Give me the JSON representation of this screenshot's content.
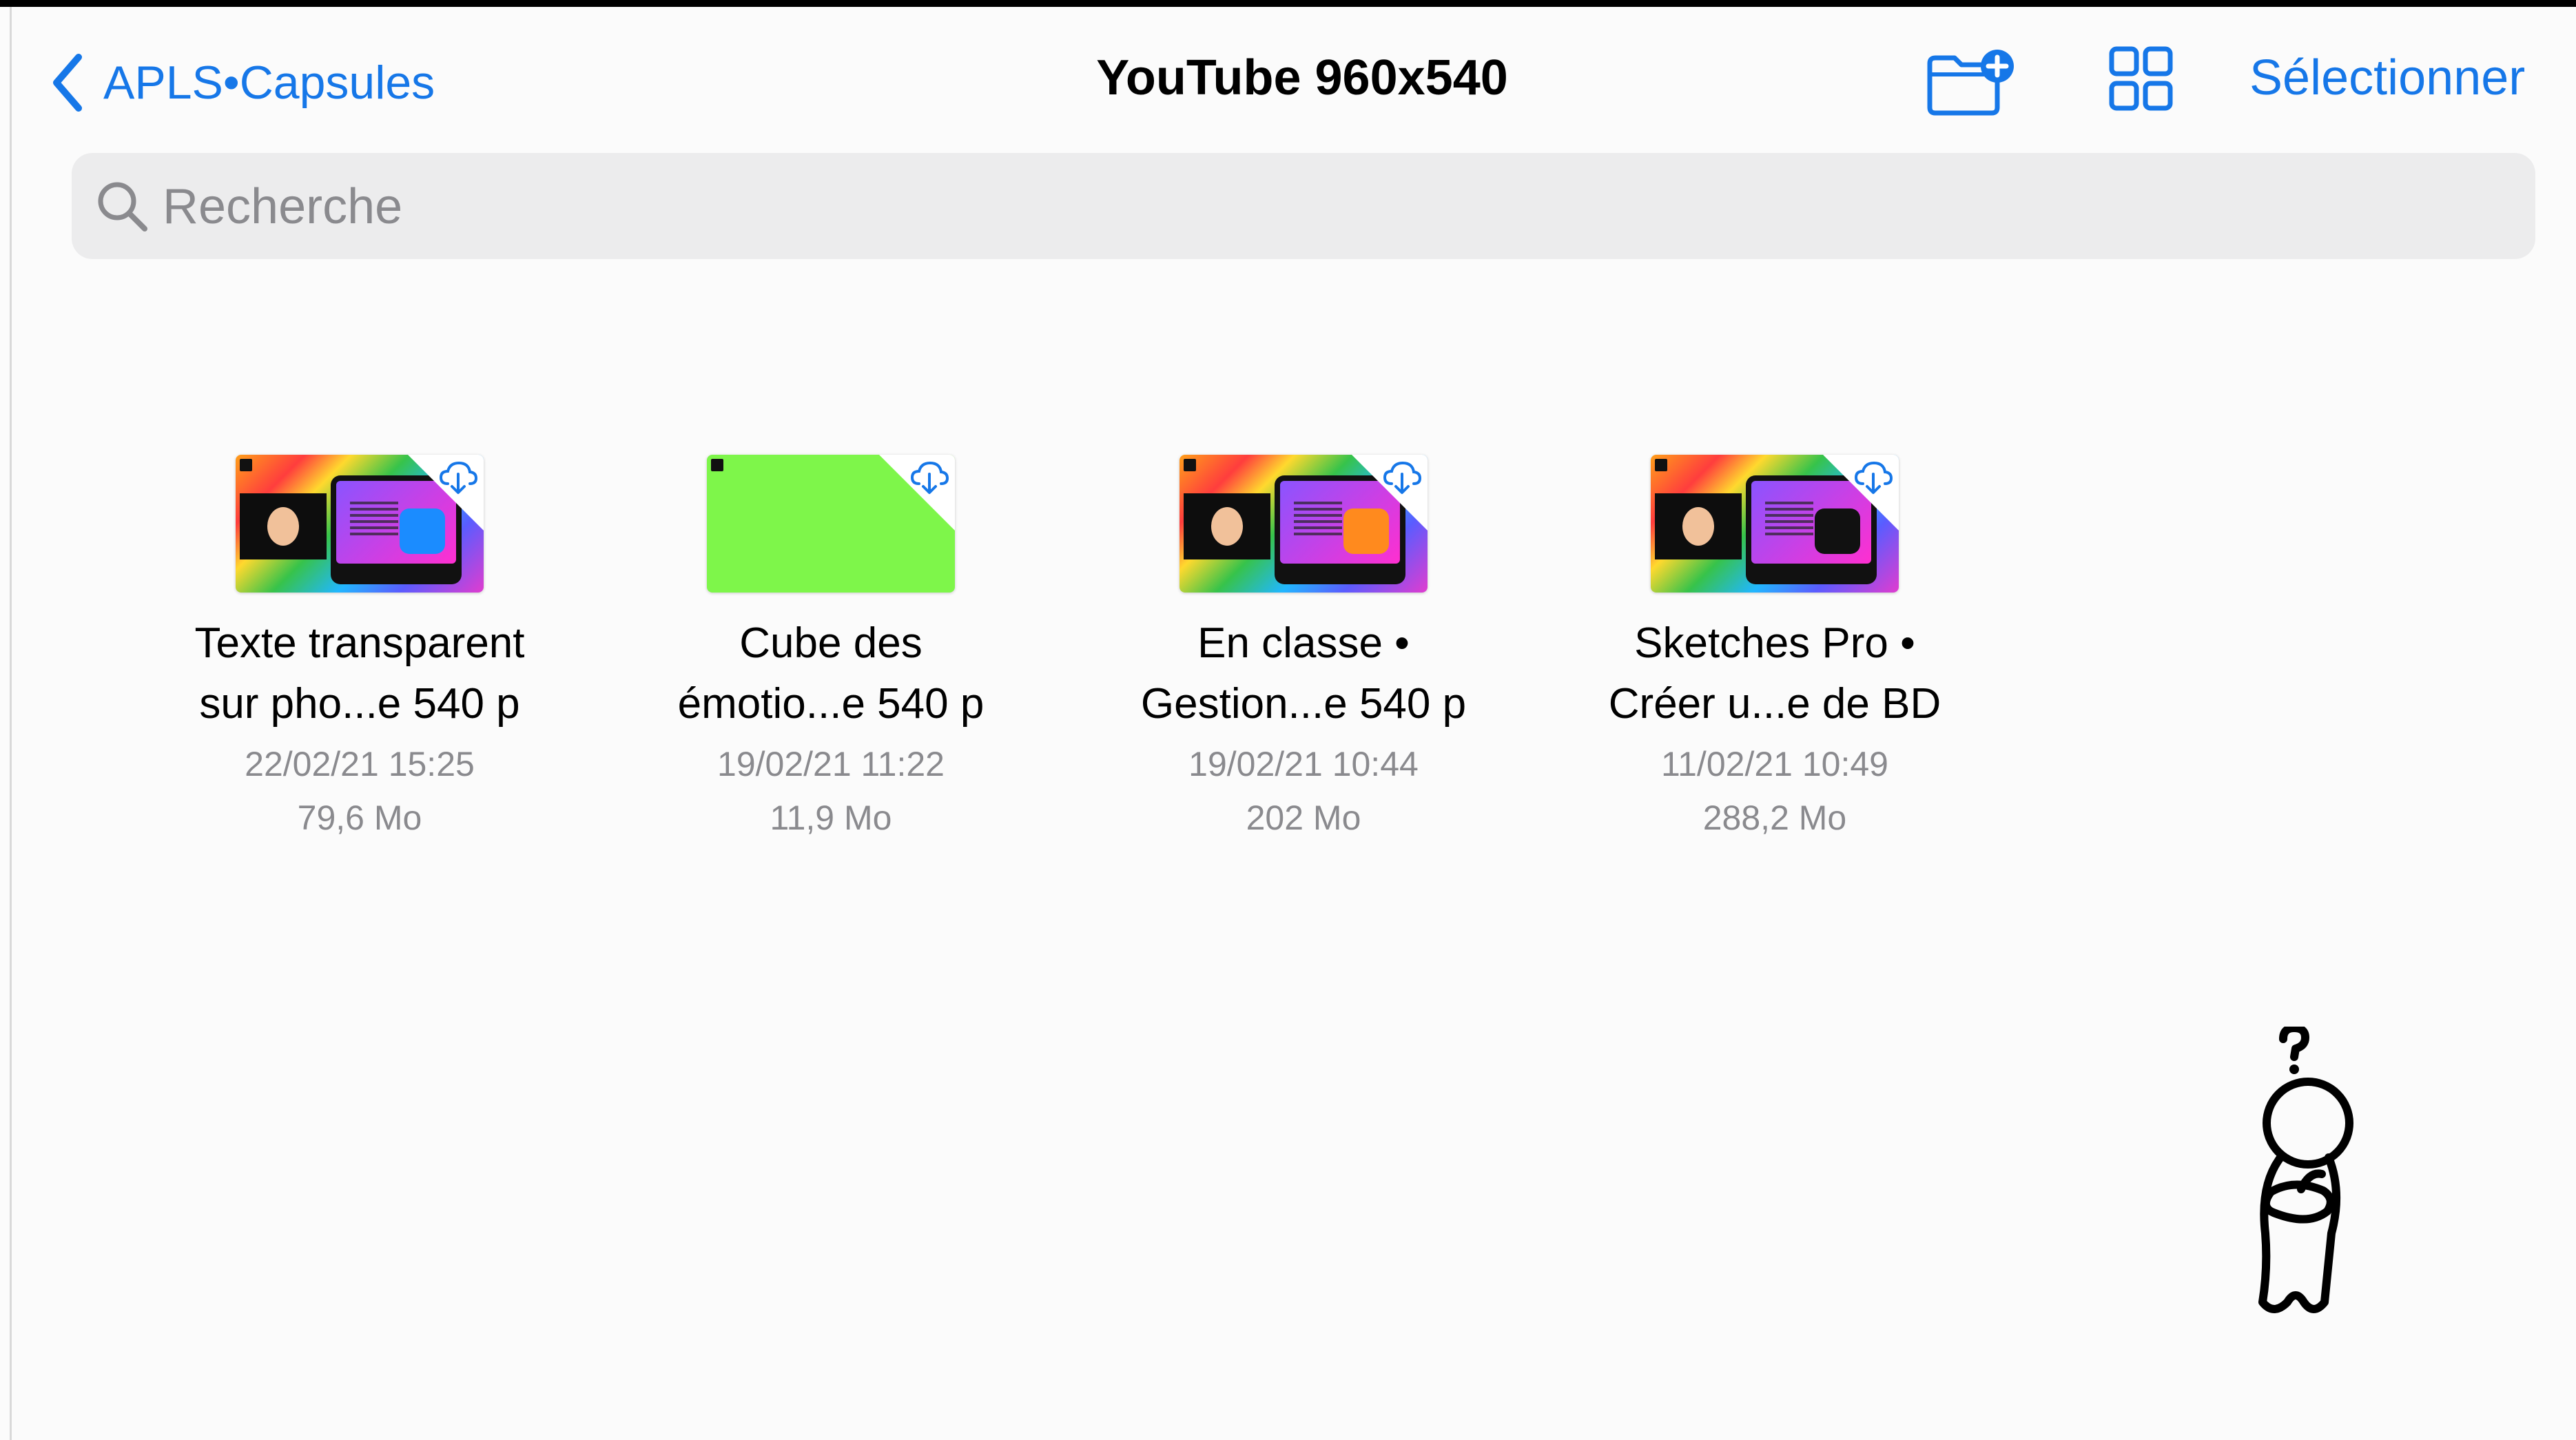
{
  "nav": {
    "back_label": "APLS•Capsules",
    "title": "YouTube 960x540",
    "new_folder_icon": "folder-badge-plus-icon",
    "view_icon": "grid-view-icon",
    "select_label": "Sélectionner"
  },
  "search": {
    "placeholder": "Recherche",
    "icon": "search-icon"
  },
  "files": [
    {
      "name_line1": "Texte transparent",
      "name_line2": "sur pho...e 540 p",
      "date": "22/02/21 15:25",
      "size": "79,6 Mo"
    },
    {
      "name_line1": "Cube des",
      "name_line2": "émotio...e 540 p",
      "date": "19/02/21 11:22",
      "size": "11,9 Mo"
    },
    {
      "name_line1": "En classe •",
      "name_line2": "Gestion...e 540 p",
      "date": "19/02/21 10:44",
      "size": "202 Mo"
    },
    {
      "name_line1": "Sketches Pro •",
      "name_line2": "Créer u...e de BD",
      "date": "11/02/21 10:49",
      "size": "288,2 Mo"
    }
  ],
  "colors": {
    "accent": "#1677e8",
    "secondary_text": "#8a8a8e",
    "search_bg": "#ececed"
  },
  "decorations": {
    "mascot": "thinking-figure-question-mark"
  }
}
